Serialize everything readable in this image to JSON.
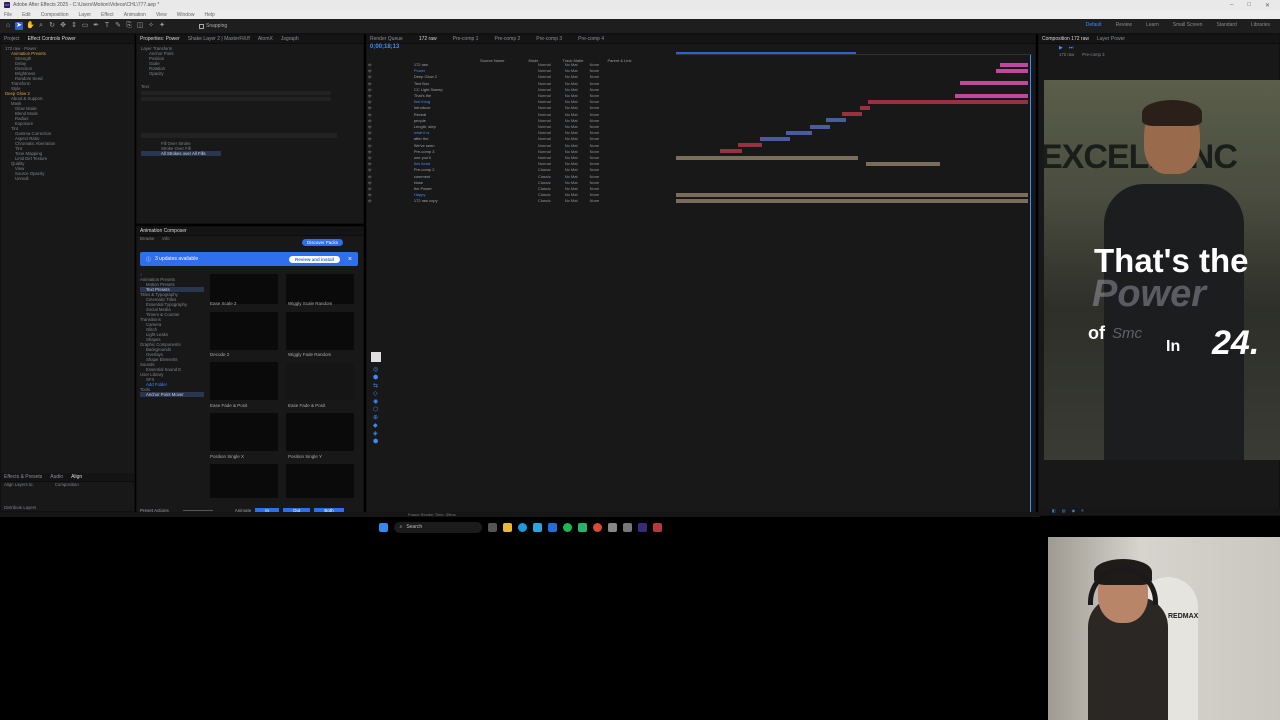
{
  "window": {
    "title": "Adobe After Effects 2025 - C:\\Users\\Motion\\Videos\\CHL\\777.aep *",
    "menus": [
      "File",
      "Edit",
      "Composition",
      "Layer",
      "Effect",
      "Animation",
      "View",
      "Window",
      "Help"
    ]
  },
  "toolbar": {
    "snapping": "Snapping",
    "workspaces": [
      "Default",
      "Review",
      "Learn",
      "Small Screen",
      "Standard",
      "Libraries"
    ]
  },
  "effect_panel": {
    "tabs": [
      "Project",
      "Effect Controls Power"
    ],
    "rows": [
      "172 raw · Power",
      "Animation Presets",
      "Strength",
      "Delay",
      "Direction",
      "Brightness",
      "Random Seed",
      "Transform",
      "Style",
      "Deep Glow 2",
      "About & Support",
      "Mask",
      "Glow Mode",
      "Blend Mode",
      "Radius",
      "Exposure",
      "Tint",
      "Gamma Correction",
      "Aspect Ratio",
      "Chromatic Aberration",
      "Tint",
      "Tone Mapping",
      "Limit Dirt Texture",
      "Quality",
      "View",
      "Source Opacity",
      "Unmult"
    ]
  },
  "props_panel": {
    "tabs": [
      "Properties: Power",
      "Shake Layer 2 | MasterFill.ff",
      "AtomX",
      "Jsgraph"
    ],
    "sections": [
      "Layer Transform",
      "Anchor Point",
      "Position",
      "Scale",
      "Rotation",
      "Opacity",
      "Text",
      "Fill Over Stroke",
      "Stroke Over Fill",
      "All Strokes over All Fills"
    ]
  },
  "anim_panel": {
    "tabs": [
      "Animation Composer",
      "Browse",
      "Info"
    ],
    "discover": "Discover Packs",
    "banner": {
      "text": "3 updates available",
      "button": "Review and install"
    },
    "categories": [
      "Animation Presets",
      "Motion Presets",
      "Text Presets",
      "Titles & Typography",
      "Cinematic Titles",
      "Essential Typography",
      "Social Media",
      "Timers & Counter",
      "Transitions",
      "Camera",
      "Glitch",
      "Light Leaks",
      "Shapes",
      "Graphic Components",
      "Backgrounds",
      "Overlays",
      "Shape Elements",
      "Sounds",
      "Essential Sound E",
      "User Library",
      "SFX",
      "Add Folder",
      "Tools",
      "Anchor Point Mover"
    ],
    "presets": [
      "Ease Scale 2",
      "Wiggly Scale Random",
      "Decode 2",
      "Wiggly Fade Random",
      "Ease Fade & Posit",
      "Ease Fade & Posit",
      "Position Single X",
      "Position Single Y"
    ],
    "footer": {
      "preset_actions": "Preset Actions",
      "animate": "Animate",
      "in": "In",
      "out": "Out",
      "both": "Both"
    },
    "sub_panel": [
      "Effects & Presets",
      "Audio",
      "Align",
      "Align Layers to:",
      "Composition",
      "Distribute Layers"
    ]
  },
  "timeline": {
    "tabs": [
      "Render Queue",
      "172 raw",
      "Pre-comp 1",
      "Pre-comp 2",
      "Pre-comp 3",
      "Pre-comp 4"
    ],
    "timecode": "0;00;18;13",
    "layers": [
      "172 raw",
      "Power",
      "Deep Glow 2",
      "Text Box",
      "CC Light Sweep",
      "That's the",
      "first thing",
      "Introduce",
      "Reveal",
      "people",
      "Length, step",
      "what it is",
      "after the",
      "We've seen",
      "Pre-comp 3",
      "one you'll",
      "this head",
      "Pre-comp 2",
      "comment",
      "Nose",
      "the Power",
      "Happy",
      "172 raw copy"
    ],
    "column_labels": [
      "Source Name",
      "Mode",
      "Track Matte",
      "Parent & Link"
    ],
    "mode_values": [
      "Normal",
      "Classic",
      "None",
      "No Mat"
    ],
    "frame_render": "Frame Render Time: 39ms"
  },
  "viewer": {
    "tabs": [
      "Composition 172 raw",
      "Layer Power"
    ],
    "crumbs": [
      "172 raw",
      "Pre-comp 3"
    ],
    "caption_line1": "That's the",
    "caption_power": "Power",
    "caption_of": "of",
    "caption_smc": "Smc",
    "caption_in": "In",
    "caption_24": "24.",
    "background_word": "EXCELLENC"
  },
  "taskbar": {
    "search": "Search"
  },
  "webcam": {
    "headset_brand": "REDMAX"
  },
  "colors": {
    "accent": "#2f6fec",
    "timecode": "#3d8bff",
    "pink_bar": "#c2479f",
    "red_bar": "#9a3140",
    "blue_bar": "#4a5b9e",
    "tan_bar": "#7a6d5a"
  }
}
